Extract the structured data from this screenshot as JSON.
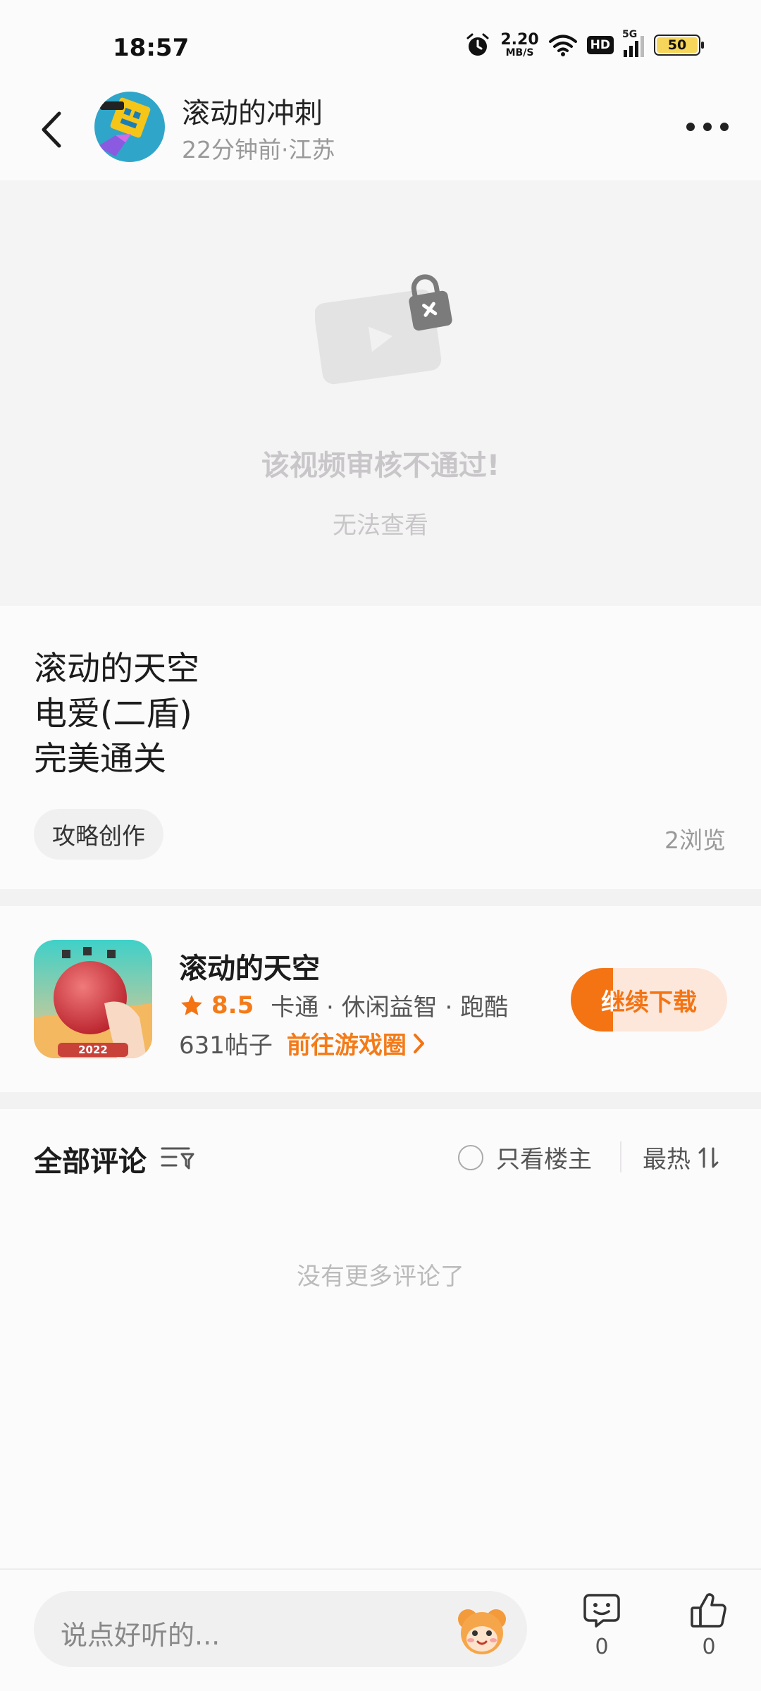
{
  "status_bar": {
    "time": "18:57",
    "net_speed_value": "2.20",
    "net_speed_unit": "MB/S",
    "hd": "HD",
    "network": "5G",
    "battery": "50"
  },
  "header": {
    "author_name": "滚动的冲刺",
    "author_meta": "22分钟前·江苏"
  },
  "video": {
    "blocked_title": "该视频审核不通过!",
    "blocked_subtitle": "无法查看"
  },
  "post": {
    "lines": [
      "滚动的天空",
      "电爱(二盾)",
      "完美通关"
    ],
    "tag": "攻略创作",
    "views": "2浏览"
  },
  "game": {
    "name": "滚动的天空",
    "rating": "8.5",
    "tags": "卡通 · 休闲益智 · 跑酷",
    "posts": "631帖子",
    "link": "前往游戏圈",
    "download_label": "继续下载",
    "download_progress": 0.27,
    "icon_year": "2022"
  },
  "comments": {
    "title": "全部评论",
    "only_op": "只看楼主",
    "sort": "最热",
    "empty": "没有更多评论了"
  },
  "bottom": {
    "input_placeholder": "说点好听的...",
    "comment_count": "0",
    "like_count": "0"
  },
  "colors": {
    "accent": "#f47414",
    "background": "#fcfbfc",
    "video_bg": "#f5f4f5"
  }
}
